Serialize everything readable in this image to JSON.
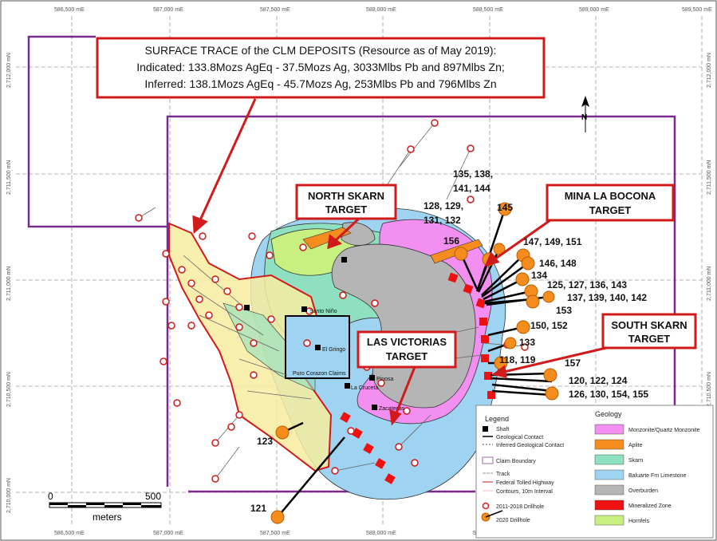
{
  "grid": {
    "easting_labels": [
      "586,500 mE",
      "587,000 mE",
      "587,500 mE",
      "588,000 mE",
      "588,500 mE",
      "589,000 mE",
      "589,500 mE"
    ],
    "northing_labels": [
      "2,712,000 mN",
      "2,711,500 mN",
      "2,711,000 mN",
      "2,710,500 mN",
      "2,710,000 mN"
    ]
  },
  "north_arrow": "N",
  "deposit_callout": {
    "line1": "SURFACE TRACE of the CLM DEPOSITS (Resource as of May 2019):",
    "line2": "Indicated: 133.8Mozs AgEq  - 37.5Mozs Ag, 3033Mlbs Pb and 897Mlbs Zn;",
    "line3": "Inferred: 138.1Mozs AgEq  -    45.7Mozs Ag, 253Mlbs Pb and 796Mlbs Zn"
  },
  "targets": {
    "north_skarn": [
      "NORTH SKARN",
      "TARGET"
    ],
    "mina_la_bocona": [
      "MINA LA BOCONA",
      "TARGET"
    ],
    "south_skarn": [
      "SOUTH SKARN",
      "TARGET"
    ],
    "las_victorias": [
      "LAS VICTORIAS",
      "TARGET"
    ]
  },
  "hole_labels": {
    "h135": "135, 138,",
    "h141": "141, 144",
    "h128": "128, 129,",
    "h131": "131, 132",
    "h145": "145",
    "h156": "156",
    "h147": "147, 149, 151",
    "h146": "146, 148",
    "h134": "134",
    "h125": "125, 127, 136, 143",
    "h137": "137, 139, 140, 142",
    "h153": "153",
    "h150": "150, 152",
    "h133": "133",
    "h118": "118, 119",
    "h157": "157",
    "h120": "120, 122, 124",
    "h126": "126, 130, 154, 155",
    "h123": "123",
    "h121": "121"
  },
  "place_names": {
    "santo_nino": "Santo Niño",
    "el_gringo": "El Gringo",
    "puro_corazon": "Puro Corazon Claims",
    "pinosa": "Pinosa",
    "la_cruceta": "La Cruceta",
    "zacatecas": "Zacatecas"
  },
  "scale_bar": {
    "start": "0",
    "end": "500",
    "unit": "meters"
  },
  "legend": {
    "title": "Legend",
    "items": [
      "Shaft",
      "Geological Contact",
      "Inferred Geological Contact",
      "Claim Boundary",
      "Track",
      "Federal Tolled Highway",
      "Contours, 10m Interval",
      "2011-2018 Drillhole",
      "2020 Drillhole"
    ],
    "geology_title": "Geology",
    "geology": [
      {
        "label": "Monzonite/Quartz Monzonite",
        "color": "#f28ff0"
      },
      {
        "label": "Aplite",
        "color": "#f58c1e"
      },
      {
        "label": "Skarn",
        "color": "#8ee0c0"
      },
      {
        "label": "Baluarte Fm Limestone",
        "color": "#9ed3f2"
      },
      {
        "label": "Overburden",
        "color": "#b5b5b5"
      },
      {
        "label": "Mineralized Zone",
        "color": "#ee1111"
      },
      {
        "label": "Hornfels",
        "color": "#c8f080"
      }
    ]
  }
}
